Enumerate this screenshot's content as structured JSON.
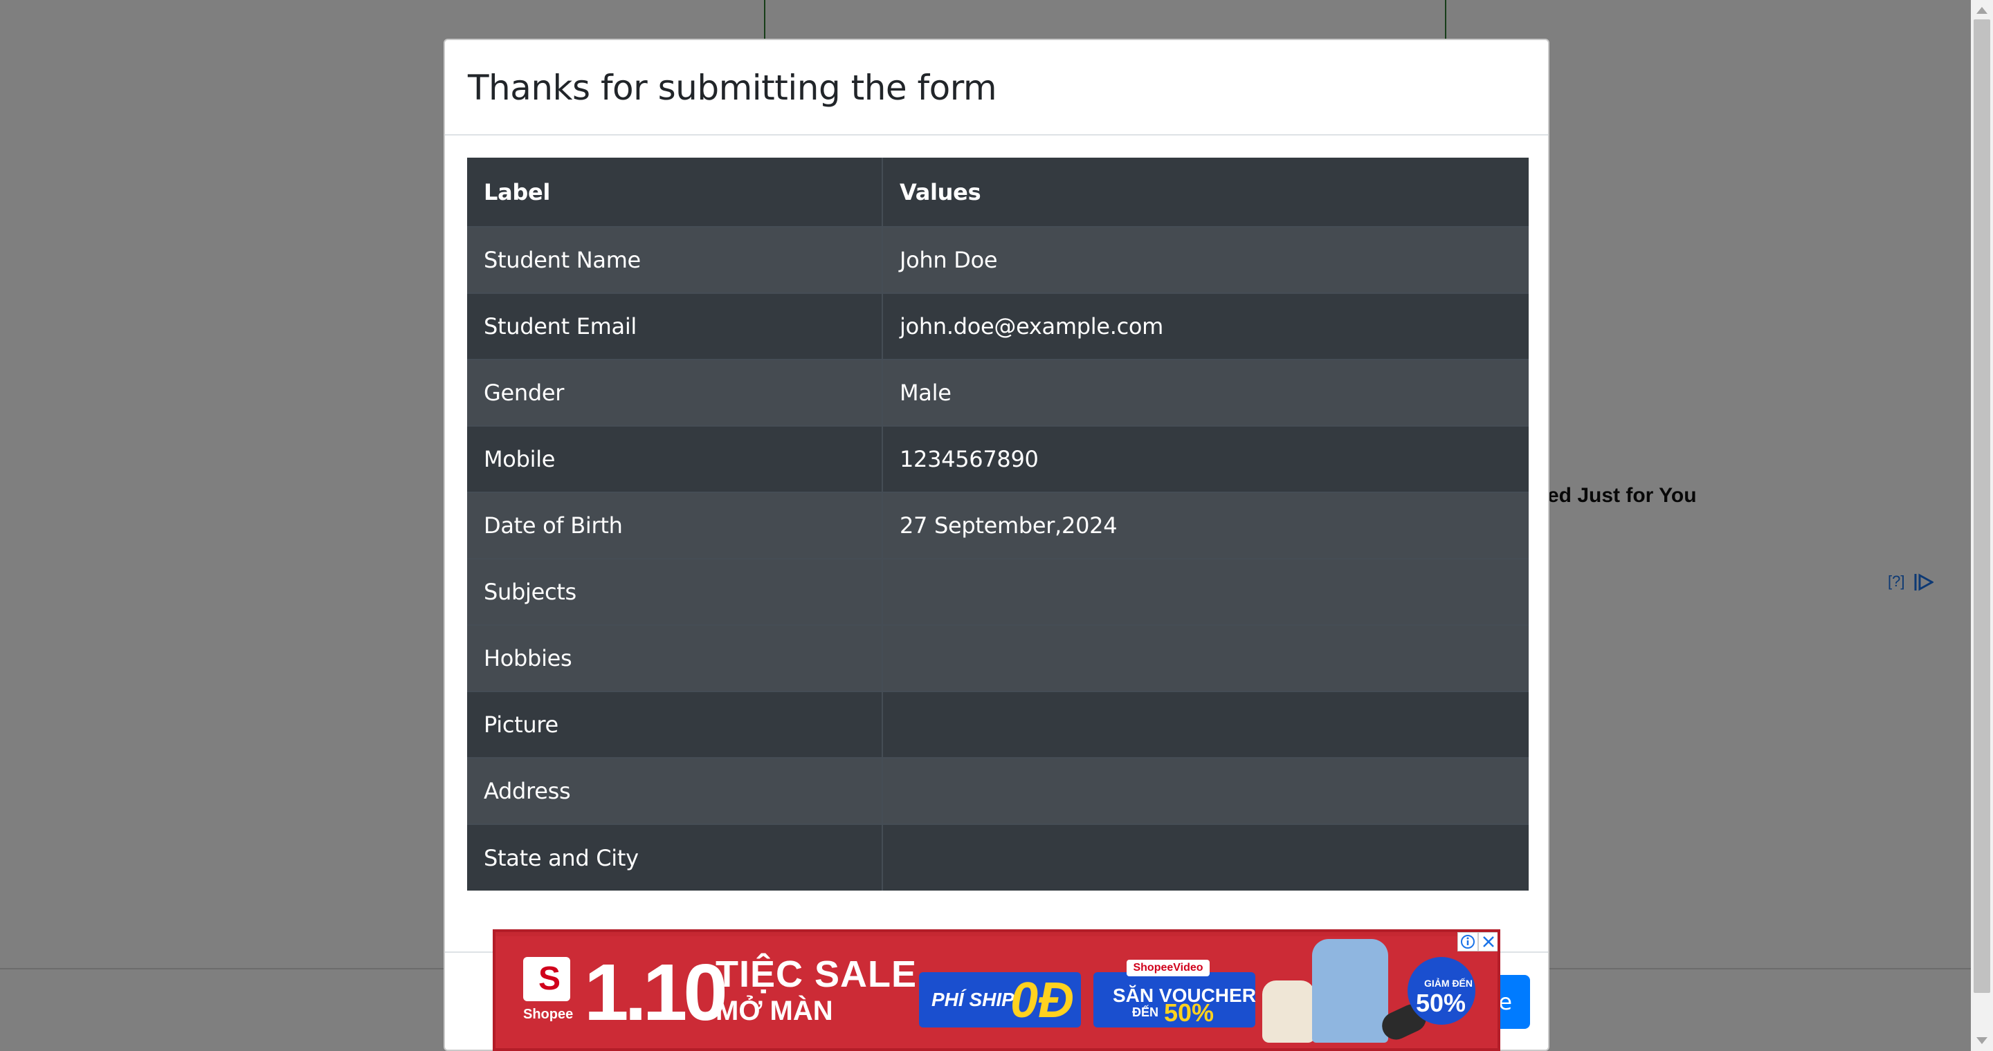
{
  "background": {
    "heading_partial": "ed Just for You",
    "adchoices_label": "[?]"
  },
  "modal": {
    "title": "Thanks for submitting the form",
    "table": {
      "headers": [
        "Label",
        "Values"
      ],
      "rows": [
        {
          "label": "Student Name",
          "value": "John Doe"
        },
        {
          "label": "Student Email",
          "value": "john.doe@example.com"
        },
        {
          "label": "Gender",
          "value": "Male"
        },
        {
          "label": "Mobile",
          "value": "1234567890"
        },
        {
          "label": "Date of Birth",
          "value": "27 September,2024"
        },
        {
          "label": "Subjects",
          "value": ""
        },
        {
          "label": "Hobbies",
          "value": ""
        },
        {
          "label": "Picture",
          "value": ""
        },
        {
          "label": "Address",
          "value": ""
        },
        {
          "label": "State and City",
          "value": ""
        }
      ]
    },
    "close_button_visible_text": "e",
    "icons": {
      "expand": "chevron-down-icon"
    }
  },
  "ad": {
    "brand": "Shopee",
    "logo_letter": "S",
    "date": "1.10",
    "sale_line1": "TIỆC SALE",
    "sale_line2": "MỞ MÀN",
    "ship_label": "PHÍ SHIP",
    "ship_value": "0Đ",
    "video_tag": "ShopeeVideo",
    "voucher_line1": "SĂN VOUCHER",
    "voucher_line2": "ĐẾN",
    "voucher_value": "50%",
    "badge_line1": "GIẢM ĐẾN",
    "badge_value": "50%",
    "colors": {
      "primary": "#c62832",
      "accent_blue": "#1a4fcf",
      "accent_yellow": "#ffd21f"
    }
  },
  "colors": {
    "table_dark": "#343a40",
    "table_stripe": "#454b51",
    "button_primary": "#007bff"
  }
}
